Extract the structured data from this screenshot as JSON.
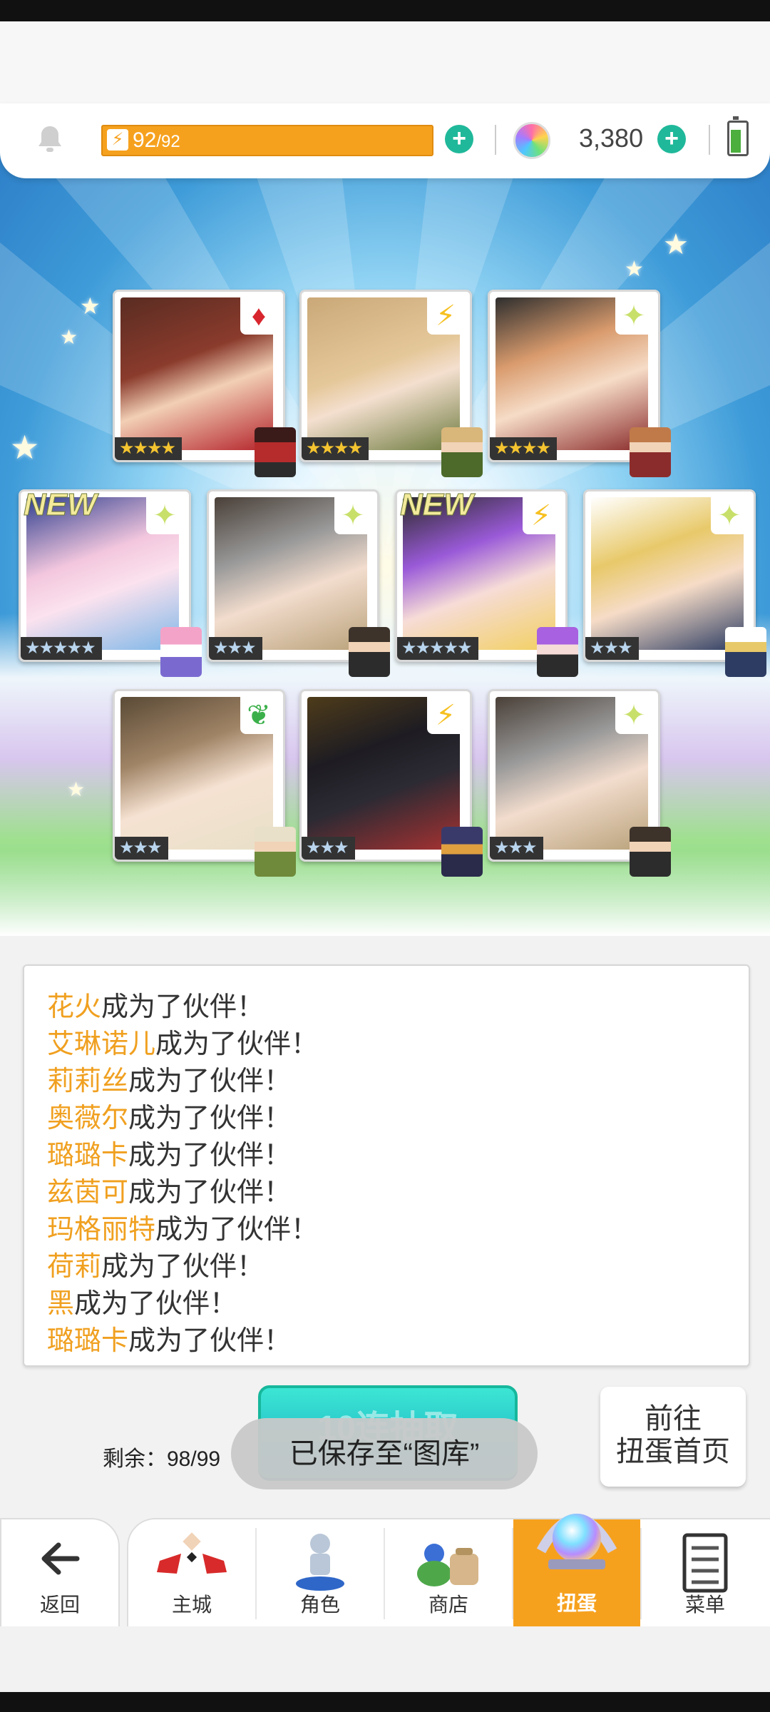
{
  "hud": {
    "energy_current": "92",
    "energy_max": "/92",
    "gem_count": "3,380"
  },
  "cards": [
    {
      "stars": "★★★★",
      "attr": "diamond",
      "new": ""
    },
    {
      "stars": "★★★★",
      "attr": "lightning",
      "new": ""
    },
    {
      "stars": "★★★★",
      "attr": "sparkle",
      "new": ""
    },
    {
      "stars": "★★★★★",
      "attr": "sparkle",
      "new": "NEW"
    },
    {
      "stars": "★★★",
      "attr": "sparkle",
      "new": ""
    },
    {
      "stars": "★★★★★",
      "attr": "lightning",
      "new": "NEW"
    },
    {
      "stars": "★★★",
      "attr": "sparkle",
      "new": ""
    },
    {
      "stars": "★★★",
      "attr": "leaf",
      "new": ""
    },
    {
      "stars": "★★★",
      "attr": "lightning",
      "new": ""
    },
    {
      "stars": "★★★",
      "attr": "sparkle",
      "new": ""
    }
  ],
  "log": {
    "suffix": "成为了伙伴！",
    "names": [
      "花火",
      "艾琳诺儿",
      "莉莉丝",
      "奥薇尔",
      "璐璐卡",
      "兹茵可",
      "玛格丽特",
      "荷莉",
      "黑",
      "璐璐卡"
    ]
  },
  "action": {
    "remaining_label": "剩余：98/99",
    "pull_label": "10连抽取",
    "goto_line1": "前往",
    "goto_line2": "扭蛋首页",
    "toast": "已保存至“图库”"
  },
  "nav": {
    "back": "返回",
    "items": [
      "主城",
      "角色",
      "商店",
      "扭蛋",
      "菜单"
    ],
    "active_index": 3,
    "accent": "#f6a11e"
  }
}
